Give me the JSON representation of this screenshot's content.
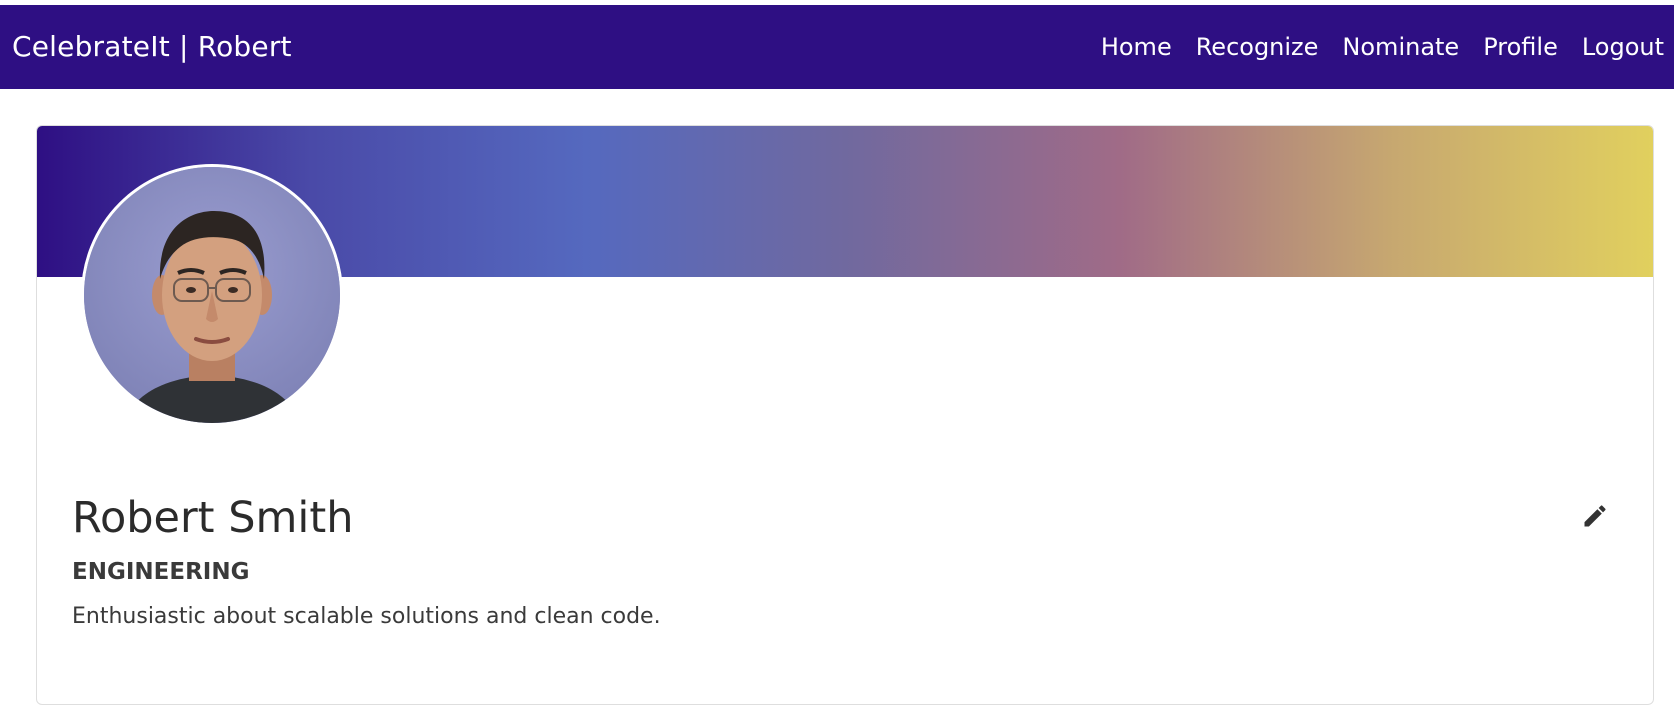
{
  "navbar": {
    "brand": "CelebrateIt | Robert",
    "links": [
      {
        "label": "Home"
      },
      {
        "label": "Recognize"
      },
      {
        "label": "Nominate"
      },
      {
        "label": "Profile"
      },
      {
        "label": "Logout"
      }
    ],
    "background_color": "#2e0f83"
  },
  "profile": {
    "name": "Robert Smith",
    "department": "ENGINEERING",
    "bio": "Enthusiastic about scalable solutions and clean code.",
    "avatar_icon": "profile-photo",
    "edit_icon": "pencil-icon",
    "banner_colors": [
      "#2e0f83",
      "#5569bf",
      "#a06b87",
      "#e1d05e"
    ]
  }
}
